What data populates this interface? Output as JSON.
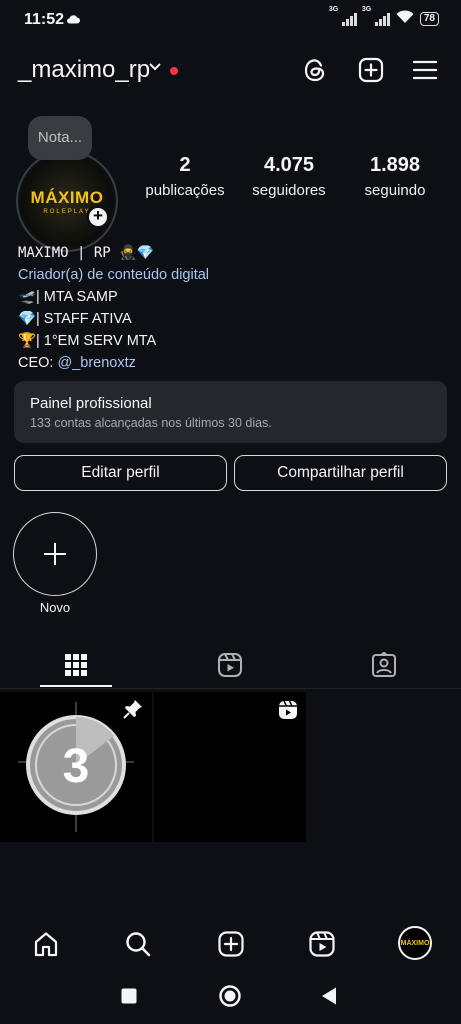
{
  "status_bar": {
    "time": "11:52",
    "cloud_icon": "cloud-icon",
    "network1": "3G",
    "network2": "3G",
    "battery": "78"
  },
  "header": {
    "username": "_maximo_rp",
    "icons": [
      "threads-icon",
      "add-post-icon",
      "menu-icon"
    ]
  },
  "profile": {
    "note": "Nota...",
    "avatar_logo": "MÁXIMO",
    "avatar_sub": "ROLEPLAY",
    "stats": [
      {
        "value": "2",
        "label": "publicações"
      },
      {
        "value": "4.075",
        "label": "seguidores"
      },
      {
        "value": "1.898",
        "label": "seguindo"
      }
    ],
    "bio": {
      "name": "MAXIMO | RP 🥷💎",
      "category": "Criador(a) de conteúdo digital",
      "line1": "| MTA SAMP",
      "line2": "| STAFF ATIVA",
      "line3": "| 1°EM SERV MTA",
      "line4_prefix": "CEO: ",
      "mention": "@_brenoxtz"
    }
  },
  "professional_panel": {
    "title": "Painel profissional",
    "subtitle": "133 contas alcançadas nos últimos 30 dias."
  },
  "buttons": {
    "edit": "Editar perfil",
    "share": "Compartilhar perfil"
  },
  "highlight": {
    "new_label": "Novo"
  },
  "tabs": [
    "grid-icon",
    "reels-icon",
    "tagged-icon"
  ],
  "grid": {
    "post1_number": "3"
  },
  "colors": {
    "background": "#0c0f14",
    "link": "#a9c7f0",
    "notification_dot": "#ff3040",
    "brand_yellow": "#f2c21a"
  }
}
